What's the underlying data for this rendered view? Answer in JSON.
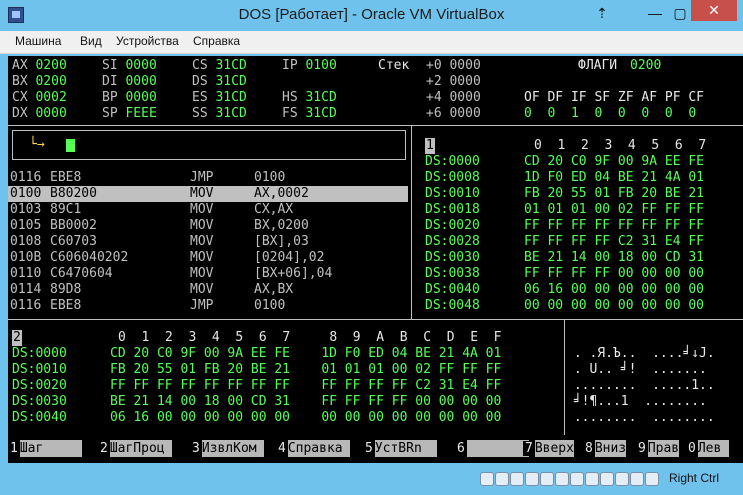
{
  "window": {
    "title": "DOS [Работает] - Oracle VM VirtualBox",
    "controls": {
      "minimize": "—",
      "maximize": "▢",
      "close": "✕",
      "pin": "⇡"
    }
  },
  "menu": [
    "Машина",
    "Вид",
    "Устройства",
    "Справка"
  ],
  "registers": [
    [
      "AX 0200",
      "SI 0000",
      "CS 31CD",
      "IP 0100"
    ],
    [
      "BX 0200",
      "DI 0000",
      "DS 31CD",
      ""
    ],
    [
      "CX 0002",
      "BP 0000",
      "ES 31CD",
      "HS 31CD"
    ],
    [
      "DX 0000",
      "SP FEEE",
      "SS 31CD",
      "FS 31CD"
    ]
  ],
  "stack": {
    "label": "Стек",
    "rows": [
      "+0 0000",
      "+2 0000",
      "+4 0000",
      "+6 0000"
    ]
  },
  "flags": {
    "label": "ФЛАГИ",
    "value": "0200",
    "names": "OF DF IF SF ZF AF PF CF",
    "values": "0  0  1  0  0  0  0  0"
  },
  "command_prompt": "└→",
  "disasm": [
    {
      "addr": "0116",
      "bytes": "EBE8",
      "mnem": "JMP",
      "ops": "0100"
    },
    {
      "addr": "0100",
      "bytes": "B80200",
      "mnem": "MOV",
      "ops": "AX,0002"
    },
    {
      "addr": "0103",
      "bytes": "89C1",
      "mnem": "MOV",
      "ops": "CX,AX"
    },
    {
      "addr": "0105",
      "bytes": "BB0002",
      "mnem": "MOV",
      "ops": "BX,0200"
    },
    {
      "addr": "0108",
      "bytes": "C60703",
      "mnem": "MOV",
      "ops": "[BX],03"
    },
    {
      "addr": "010B",
      "bytes": "C606040202",
      "mnem": "MOV",
      "ops": "[0204],02"
    },
    {
      "addr": "0110",
      "bytes": "C6470604",
      "mnem": "MOV",
      "ops": "[BX+06],04"
    },
    {
      "addr": "0114",
      "bytes": "89D8",
      "mnem": "MOV",
      "ops": "AX,BX"
    },
    {
      "addr": "0116",
      "bytes": "EBE8",
      "mnem": "JMP",
      "ops": "0100"
    }
  ],
  "dump1": {
    "number": "1",
    "header": "0  1  2  3  4  5  6  7",
    "rows": [
      {
        "addr": "DS:0000",
        "bytes": "CD 20 C0 9F 00 9A EE FE"
      },
      {
        "addr": "DS:0008",
        "bytes": "1D F0 ED 04 BE 21 4A 01"
      },
      {
        "addr": "DS:0010",
        "bytes": "FB 20 55 01 FB 20 BE 21"
      },
      {
        "addr": "DS:0018",
        "bytes": "01 01 01 00 02 FF FF FF"
      },
      {
        "addr": "DS:0020",
        "bytes": "FF FF FF FF FF FF FF FF"
      },
      {
        "addr": "DS:0028",
        "bytes": "FF FF FF FF C2 31 E4 FF"
      },
      {
        "addr": "DS:0030",
        "bytes": "BE 21 14 00 18 00 CD 31"
      },
      {
        "addr": "DS:0038",
        "bytes": "FF FF FF FF 00 00 00 00"
      },
      {
        "addr": "DS:0040",
        "bytes": "06 16 00 00 00 00 00 00"
      },
      {
        "addr": "DS:0048",
        "bytes": "00 00 00 00 00 00 00 00"
      }
    ]
  },
  "dump2": {
    "number": "2",
    "header": "0  1  2  3  4  5  6  7     8  9  A  B  C  D  E  F",
    "rows": [
      {
        "addr": "DS:0000",
        "bytes": "CD 20 C0 9F 00 9A EE FE    1D F0 ED 04 BE 21 4A 01",
        "ascii": " . .Я.Ъ..  ....╛↓J."
      },
      {
        "addr": "DS:0010",
        "bytes": "FB 20 55 01 FB 20 BE 21    01 01 01 00 02 FF FF FF",
        "ascii": " . U.. ╛!  ......."
      },
      {
        "addr": "DS:0020",
        "bytes": "FF FF FF FF FF FF FF FF    FF FF FF FF C2 31 E4 FF",
        "ascii": " ........  .....1.."
      },
      {
        "addr": "DS:0030",
        "bytes": "BE 21 14 00 18 00 CD 31    FF FF FF FF 00 00 00 00",
        "ascii": " ╛!¶...1  ........"
      },
      {
        "addr": "DS:0040",
        "bytes": "06 16 00 00 00 00 00 00    00 00 00 00 00 00 00 00",
        "ascii": " ........  ........"
      }
    ]
  },
  "fkeys": [
    {
      "n": "1",
      "label": "Шаг     "
    },
    {
      "n": "2",
      "label": "ШагПроц "
    },
    {
      "n": "3",
      "label": "ИзвлКом "
    },
    {
      "n": "4",
      "label": "Справка "
    },
    {
      "n": "5",
      "label": "УстBRn  "
    },
    {
      "n": "6",
      "label": "        "
    },
    {
      "n": "7",
      "label": "Вверх"
    },
    {
      "n": "8",
      "label": "Вниз"
    },
    {
      "n": "9",
      "label": "Прав"
    },
    {
      "n": "0",
      "label": "Лев "
    }
  ],
  "statusbar": {
    "host_key": "Right Ctrl",
    "icons": [
      "hdd-icon",
      "cd-icon",
      "floppy-icon",
      "audio-icon",
      "network-icon",
      "usb-icon",
      "shared-folder-icon",
      "display-icon",
      "video-capture-icon",
      "usb-device-icon",
      "mouse-integration-icon",
      "arrow-down-icon"
    ]
  },
  "colors": {
    "terminal_bg": "#000000",
    "terminal_text": "#c0c0c0",
    "value_green": "#55ff55",
    "highlight": "#c0c0c0",
    "window_frame": "#6fc2eb"
  }
}
